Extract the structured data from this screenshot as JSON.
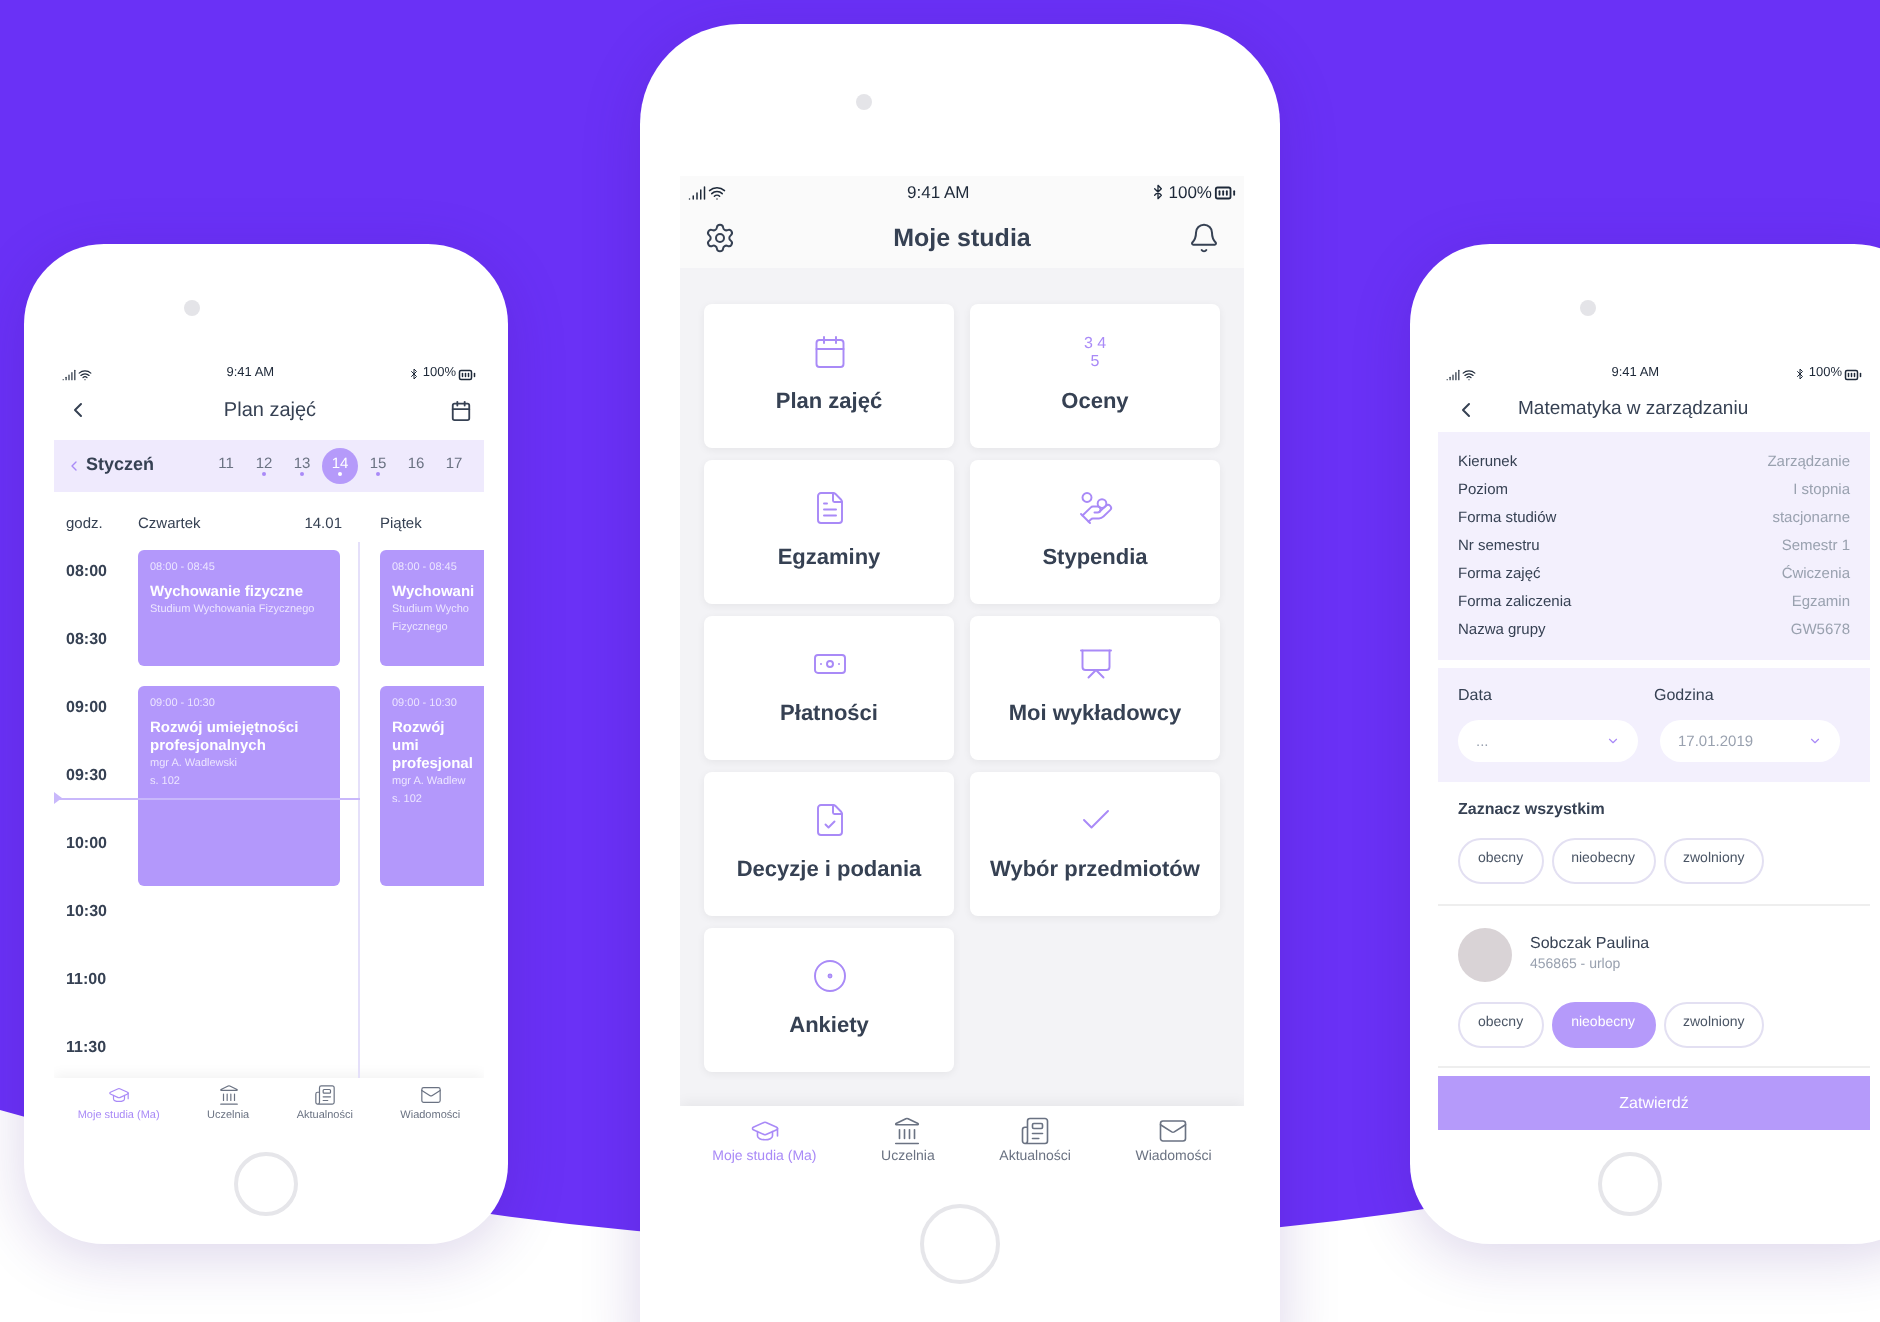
{
  "phones": [
    {
      "kind": "schedule",
      "status": {
        "time": "9:41 AM",
        "battery": "100%"
      },
      "title": "Plan zajęć",
      "month": "Styczeń",
      "days": [
        {
          "label": "11",
          "selected": false,
          "has_events": false
        },
        {
          "label": "12",
          "selected": false,
          "has_events": true
        },
        {
          "label": "13",
          "selected": false,
          "has_events": true
        },
        {
          "label": "14",
          "selected": true,
          "has_events": true
        },
        {
          "label": "15",
          "selected": false,
          "has_events": true
        },
        {
          "label": "16",
          "selected": false,
          "has_events": false
        },
        {
          "label": "17",
          "selected": false,
          "has_events": false
        }
      ],
      "time_header": "godz.",
      "hours": [
        "08:00",
        "08:30",
        "09:00",
        "09:30",
        "10:00",
        "10:30",
        "11:00",
        "11:30"
      ],
      "columns": [
        {
          "day": "Czwartek",
          "date": "14.01",
          "events": [
            {
              "time": "08:00 - 08:45",
              "title": "Wychowanie fizyczne",
              "details": [
                "Studium Wychowania Fizycznego"
              ]
            },
            {
              "time": "09:00 - 10:30",
              "title": "Rozwój umiejętności profesjonalnych",
              "details": [
                "mgr A. Wadlewski",
                "s. 102"
              ]
            }
          ]
        },
        {
          "day": "Piątek",
          "events": [
            {
              "time": "08:00 - 08:45",
              "title": "Wychowani",
              "details": [
                "Studium Wycho",
                "Fizycznego"
              ]
            },
            {
              "time": "09:00 - 10:30",
              "title": "Rozwój umi profesjonal",
              "details": [
                "mgr A. Wadlew",
                "s. 102"
              ]
            }
          ]
        }
      ],
      "tabs": [
        {
          "label": "Moje studia (Ma)",
          "selected": true
        },
        {
          "label": "Uczelnia",
          "selected": false
        },
        {
          "label": "Aktualności",
          "selected": false
        },
        {
          "label": "Wiadomości",
          "selected": false
        }
      ]
    },
    {
      "kind": "dashboard",
      "status": {
        "time": "9:41 AM",
        "battery": "100%"
      },
      "title": "Moje studia",
      "tiles": [
        {
          "label": "Plan zajęć"
        },
        {
          "label": "Oceny"
        },
        {
          "label": "Egzaminy"
        },
        {
          "label": "Stypendia"
        },
        {
          "label": "Płatności"
        },
        {
          "label": "Moi wykładowcy"
        },
        {
          "label": "Decyzje i podania"
        },
        {
          "label": "Wybór przedmiotów"
        },
        {
          "label": "Ankiety"
        }
      ],
      "grades_glyph": [
        "3 4",
        "5"
      ],
      "tabs": [
        {
          "label": "Moje studia (Ma)",
          "selected": true
        },
        {
          "label": "Uczelnia",
          "selected": false
        },
        {
          "label": "Aktualności",
          "selected": false
        },
        {
          "label": "Wiadomości",
          "selected": false
        }
      ]
    },
    {
      "kind": "attendance",
      "status": {
        "time": "9:41 AM",
        "battery": "100%"
      },
      "title": "Matematyka w zarządzaniu",
      "details": [
        {
          "label": "Kierunek",
          "value": "Zarządzanie"
        },
        {
          "label": "Poziom",
          "value": "I stopnia"
        },
        {
          "label": "Forma studiów",
          "value": "stacjonarne"
        },
        {
          "label": "Nr semestru",
          "value": "Semestr 1"
        },
        {
          "label": "Forma zajęć",
          "value": "Ćwiczenia"
        },
        {
          "label": "Forma zaliczenia",
          "value": "Egzamin"
        },
        {
          "label": "Nazwa grupy",
          "value": "GW5678"
        }
      ],
      "date_label": "Data",
      "time_label": "Godzina",
      "date_value": "...",
      "time_value": "17.01.2019",
      "select_all": "Zaznacz wszystkim",
      "all_options": [
        {
          "label": "obecny",
          "selected": false
        },
        {
          "label": "nieobecny",
          "selected": false
        },
        {
          "label": "zwolniony",
          "selected": false
        }
      ],
      "students": [
        {
          "name": "Sobczak Paulina",
          "info": "456865 - urlop",
          "options": [
            {
              "label": "obecny",
              "selected": false
            },
            {
              "label": "nieobecny",
              "selected": true
            },
            {
              "label": "zwolniony",
              "selected": false
            }
          ]
        }
      ],
      "submit": "Zatwierdź"
    }
  ]
}
